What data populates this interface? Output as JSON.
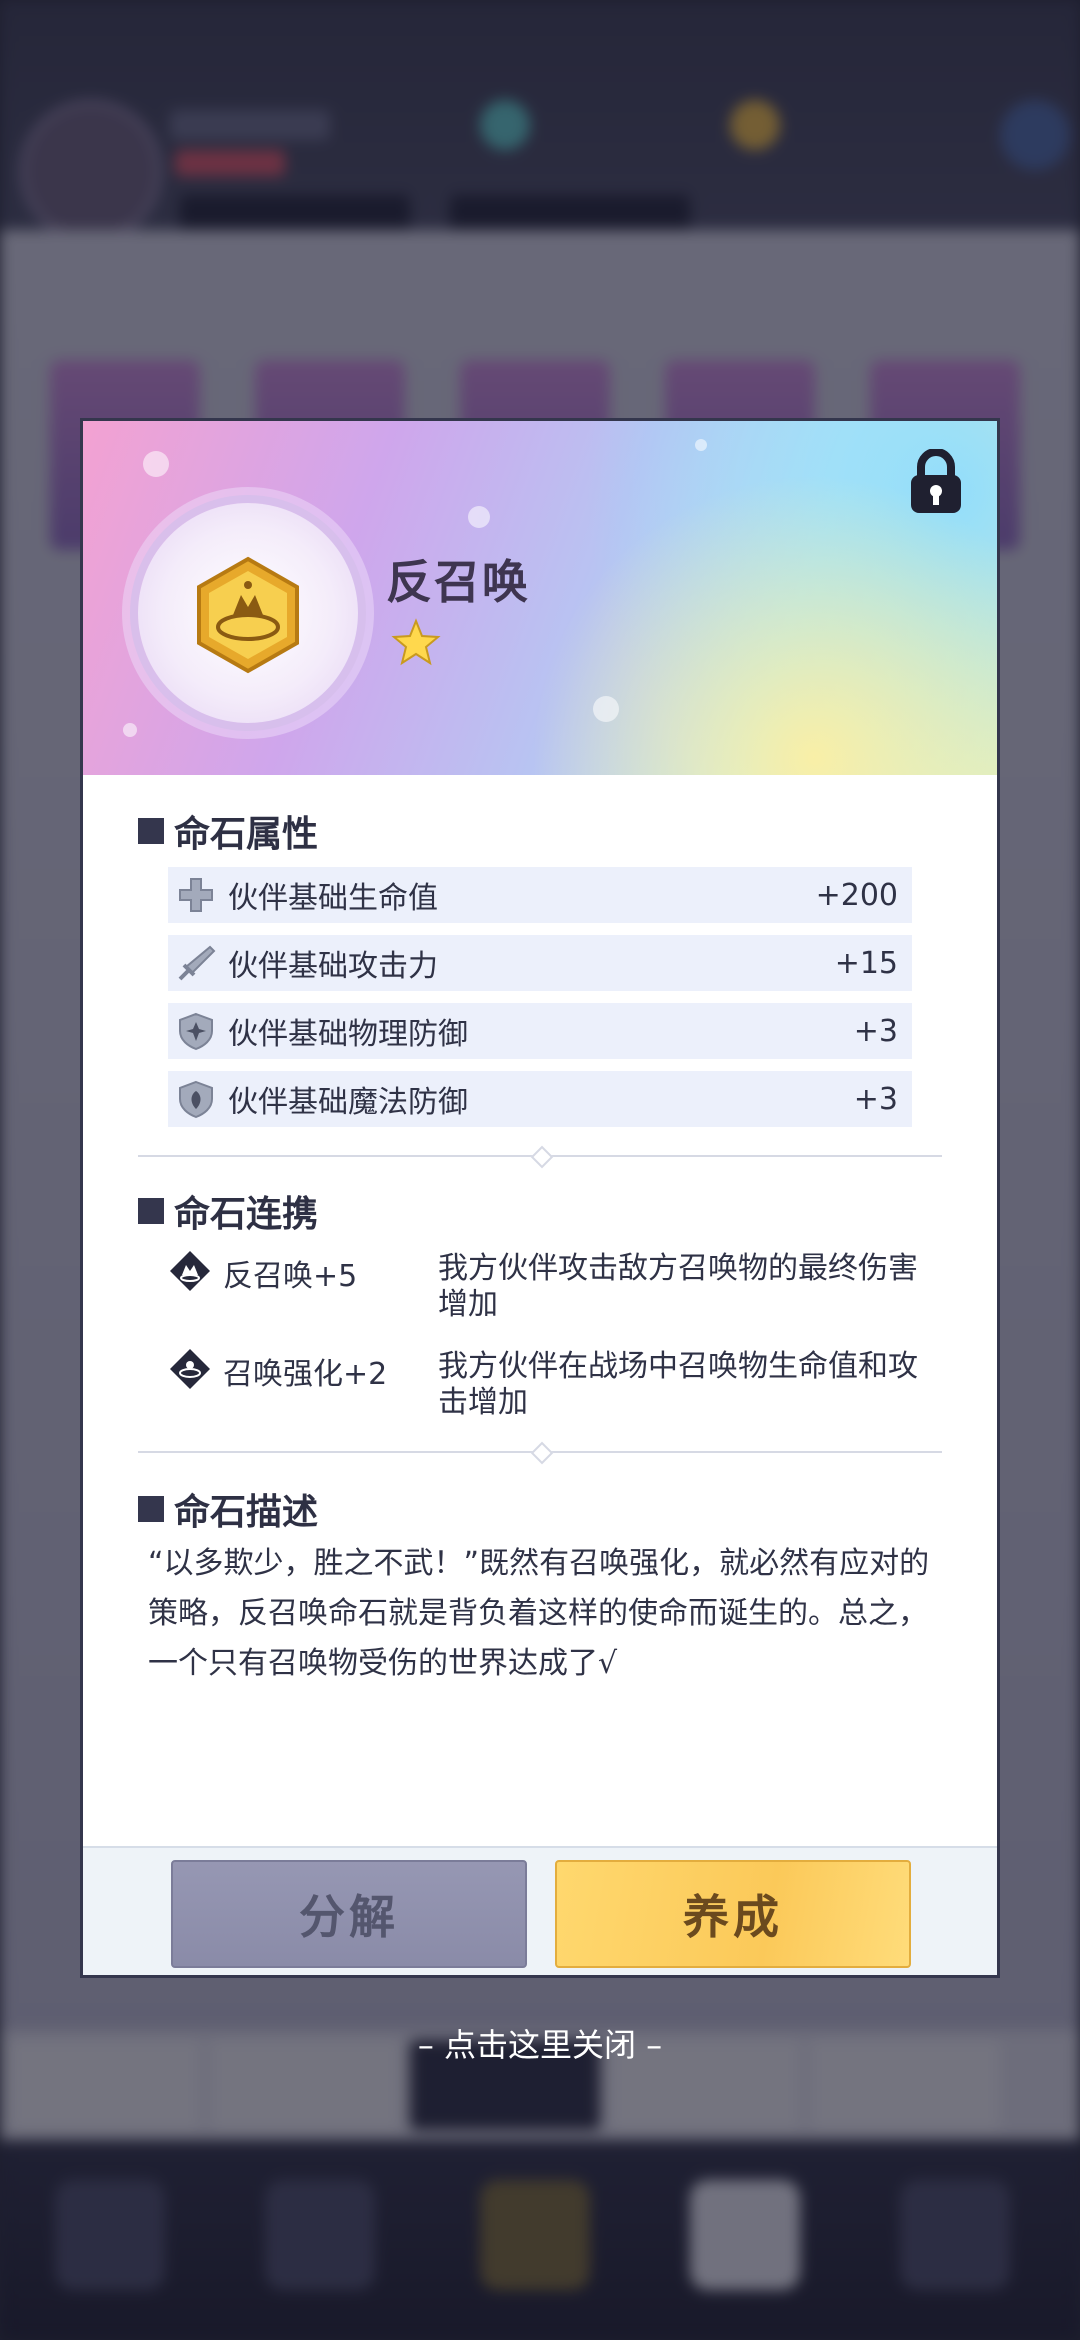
{
  "item": {
    "name": "反召唤",
    "stars": 1
  },
  "attributes": {
    "title": "命石属性",
    "rows": [
      {
        "icon": "plus-icon",
        "label": "伙伴基础生命值",
        "value": "+200"
      },
      {
        "icon": "sword-icon",
        "label": "伙伴基础攻击力",
        "value": "+15"
      },
      {
        "icon": "shield-star-icon",
        "label": "伙伴基础物理防御",
        "value": "+3"
      },
      {
        "icon": "shield-magic-icon",
        "label": "伙伴基础魔法防御",
        "value": "+3"
      }
    ]
  },
  "links": {
    "title": "命石连携",
    "rows": [
      {
        "icon": "anti-summon-icon",
        "name": "反召唤+5",
        "desc": "我方伙伴攻击敌方召唤物的最终伤害增加"
      },
      {
        "icon": "summon-boost-icon",
        "name": "召唤强化+2",
        "desc": "我方伙伴在战场中召唤物生命值和攻击增加"
      }
    ]
  },
  "description": {
    "title": "命石描述",
    "text": "“以多欺少，胜之不武！”既然有召唤强化，就必然有应对的策略，反召唤命石就是背负着这样的使命而诞生的。总之，一个只有召唤物受伤的世界达成了√"
  },
  "buttons": {
    "decompose": "分解",
    "cultivate": "养成"
  },
  "close_hint": "– 点击这里关闭 –",
  "colors": {
    "dark": "#34364d",
    "accent_yellow": "#fbc959",
    "row_bg": "#ecf0fb"
  }
}
